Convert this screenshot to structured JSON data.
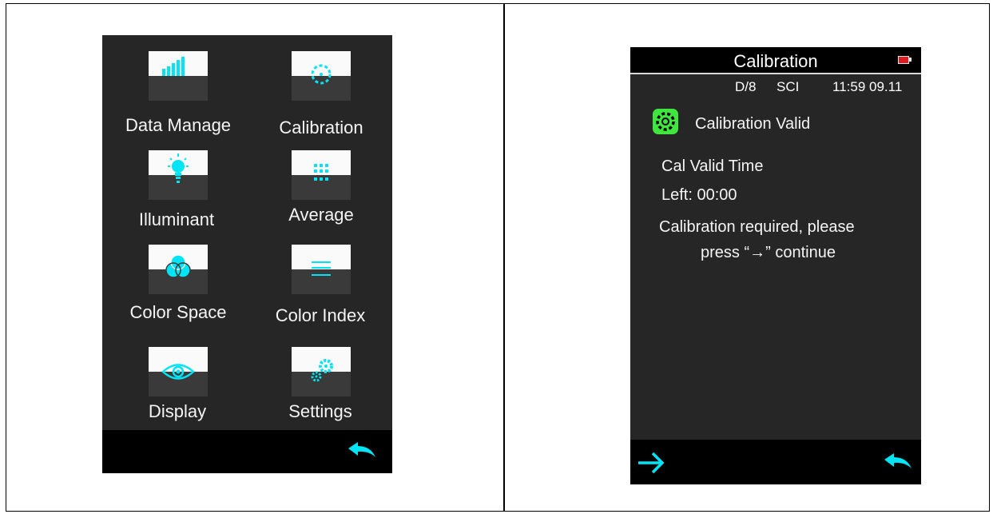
{
  "menu": {
    "items": [
      {
        "label": "Data Manage",
        "icon": "signal-bars-icon"
      },
      {
        "label": "Calibration",
        "icon": "calibration-target-icon"
      },
      {
        "label": "Illuminant",
        "icon": "light-bulb-icon"
      },
      {
        "label": "Average",
        "icon": "grid-dots-icon"
      },
      {
        "label": "Color Space",
        "icon": "color-circles-icon"
      },
      {
        "label": "Color Index",
        "icon": "lines-icon"
      },
      {
        "label": "Display",
        "icon": "eye-icon"
      },
      {
        "label": "Settings",
        "icon": "gears-icon"
      }
    ],
    "back_icon": "back-arrow-icon"
  },
  "calibration": {
    "title": "Calibration",
    "geometry": "D/8",
    "mode": "SCI",
    "datetime": "11:59 09.11",
    "status": "Calibration Valid",
    "valid_time_label": "Cal Valid Time",
    "left_label": "Left: 00:00",
    "message_line1": "Calibration required, please",
    "message_line2": "press “→” continue",
    "next_icon": "right-arrow-icon",
    "back_icon": "back-arrow-icon"
  },
  "colors": {
    "accent": "#00e5f5",
    "valid_green": "#3ee63e",
    "battery_low": "#e01b24"
  }
}
